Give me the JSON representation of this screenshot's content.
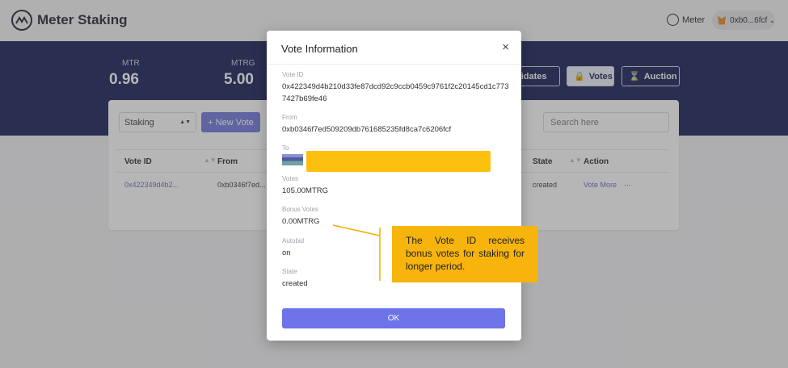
{
  "app": {
    "title": "Meter Staking"
  },
  "header": {
    "network": "Meter",
    "wallet": "0xb0...6fcf"
  },
  "stats": [
    {
      "label": "MTR",
      "value": "0.96"
    },
    {
      "label": "MTRG",
      "value": "5.00"
    }
  ],
  "nav": {
    "candidates": "didates",
    "votes": "Votes",
    "auction": "Auction"
  },
  "toolbar": {
    "filter_value": "Staking",
    "new_vote": "+ New Vote",
    "search_placeholder": "Search here"
  },
  "table": {
    "headers": [
      "Vote ID",
      "From",
      "State",
      "Action"
    ],
    "rows": [
      {
        "vote_id": "0x422349d4b2...",
        "from": "0xb0346f7ed...",
        "state": "created",
        "action": "Vote More",
        "more": "···"
      }
    ]
  },
  "modal": {
    "title": "Vote Information",
    "close": "×",
    "fields": {
      "vote_id": {
        "label": "Vote ID",
        "value": "0x422349d4b210d33fe87dcd92c9ccb0459c9761f2c20145cd1c7737427b69fe46"
      },
      "from": {
        "label": "From",
        "value": "0xb0346f7ed509209db761685235fd8ca7c6206fcf"
      },
      "to": {
        "label": "To"
      },
      "votes": {
        "label": "Votes",
        "value": "105.00MTRG"
      },
      "bonus_votes": {
        "label": "Bonus Votes",
        "value": "0.00MTRG"
      },
      "autobid": {
        "label": "Autobid",
        "value": "on"
      },
      "state": {
        "label": "State",
        "value": "created"
      }
    },
    "ok": "OK"
  },
  "annotation": {
    "text": "The Vote ID receives bonus votes for staking for longer period."
  },
  "colors": {
    "brand_navy": "#0f1852",
    "accent": "#6d73e8",
    "highlight": "#fdc00f",
    "callout": "#f6b40c"
  }
}
